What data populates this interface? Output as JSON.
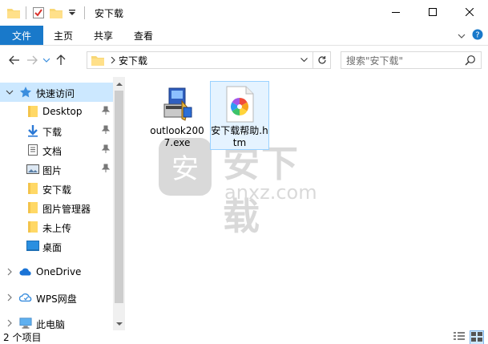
{
  "window": {
    "title": "安下载"
  },
  "ribbon": {
    "tabs": [
      "文件",
      "主页",
      "共享",
      "查看"
    ]
  },
  "address": {
    "crumb": "安下载",
    "search_placeholder": "搜索\"安下载\""
  },
  "navpane": {
    "items": [
      {
        "label": "快速访问",
        "icon": "star-icon"
      },
      {
        "label": "Desktop",
        "icon": "folder-icon",
        "pinned": true
      },
      {
        "label": "下载",
        "icon": "download-arrow-icon",
        "pinned": true
      },
      {
        "label": "文档",
        "icon": "document-icon",
        "pinned": true
      },
      {
        "label": "图片",
        "icon": "picture-icon",
        "pinned": true
      },
      {
        "label": "安下载",
        "icon": "folder-icon"
      },
      {
        "label": "图片管理器",
        "icon": "folder-icon"
      },
      {
        "label": "未上传",
        "icon": "folder-icon"
      },
      {
        "label": "桌面",
        "icon": "desktop-icon"
      },
      {
        "label": "OneDrive",
        "icon": "cloud-icon"
      },
      {
        "label": "WPS网盘",
        "icon": "wps-cloud-icon"
      },
      {
        "label": "此电脑",
        "icon": "computer-icon"
      }
    ]
  },
  "files": [
    {
      "name": "outlook2007.exe",
      "icon": "installer-icon"
    },
    {
      "name": "安下载帮助.htm",
      "icon": "htm-file-icon"
    }
  ],
  "watermark": {
    "text": "安下载",
    "sub": "anxz.com",
    "badge": "安"
  },
  "status": {
    "count": "2 个项目"
  },
  "colors": {
    "file_tab": "#1979ca",
    "selection": "#cce8ff",
    "folder": "#ffd866"
  }
}
